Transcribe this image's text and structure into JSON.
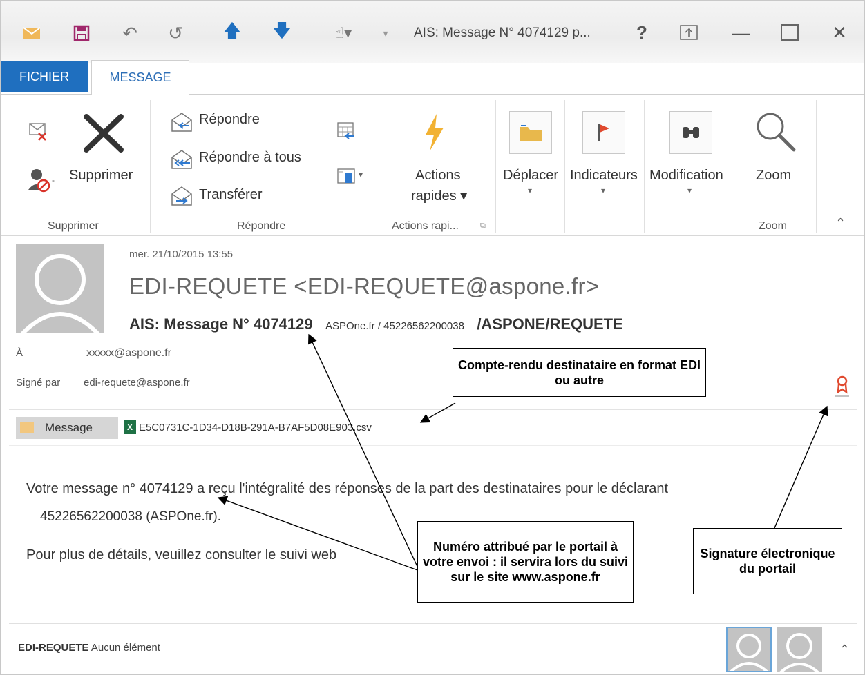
{
  "window": {
    "title": "AIS: Message N° 4074129 p...",
    "help": "?",
    "minimize": "—",
    "close": "✕"
  },
  "tabs": {
    "fichier": "FICHIER",
    "message": "MESSAGE"
  },
  "ribbon": {
    "supprimer_btn": "Supprimer",
    "supprimer_group": "Supprimer",
    "repondre": "Répondre",
    "repondre_tous": "Répondre à tous",
    "transferer": "Transférer",
    "repondre_group": "Répondre",
    "actions_line1": "Actions",
    "actions_line2": "rapides ▾",
    "actions_group": "Actions rapi...",
    "deplacer": "Déplacer",
    "indicateurs": "Indicateurs",
    "modification": "Modification",
    "zoom": "Zoom",
    "zoom_group": "Zoom"
  },
  "header": {
    "date": "mer. 21/10/2015 13:55",
    "sender": "EDI-REQUETE <EDI-REQUETE@aspone.fr>",
    "subject_main": "AIS: Message N° 4074129",
    "subject_small": "ASPOne.fr / 45226562200038",
    "subject_tail": "/ASPONE/REQUETE",
    "a_label": "À",
    "a_value": "xxxxx@aspone.fr",
    "signed_label": "Signé par",
    "signed_value": "edi-requete@aspone.fr"
  },
  "attachments": {
    "message_label": "Message",
    "csv_name": "E5C0731C-1D34-D18B-291A-B7AF5D08E903.csv"
  },
  "body": {
    "line1": "Votre message n° 4074129 a reçu l'intégralité des réponses de la part des destinataires pour le déclarant",
    "line1b": "45226562200038 (ASPOne.fr).",
    "line2": "Pour plus de détails, veuillez consulter le suivi web"
  },
  "footer": {
    "name": "EDI-REQUETE",
    "status": "Aucun élément"
  },
  "callouts": {
    "compte_rendu": "Compte-rendu destinataire en format EDI ou autre",
    "numero": "Numéro attribué par le portail à votre envoi : il servira lors du suivi sur le site www.aspone.fr",
    "signature": "Signature électronique du portail"
  },
  "colors": {
    "accent": "#1f6fbf",
    "tab_text": "#2e6fb7",
    "excel": "#1e7145",
    "flag": "#e04a2f"
  }
}
